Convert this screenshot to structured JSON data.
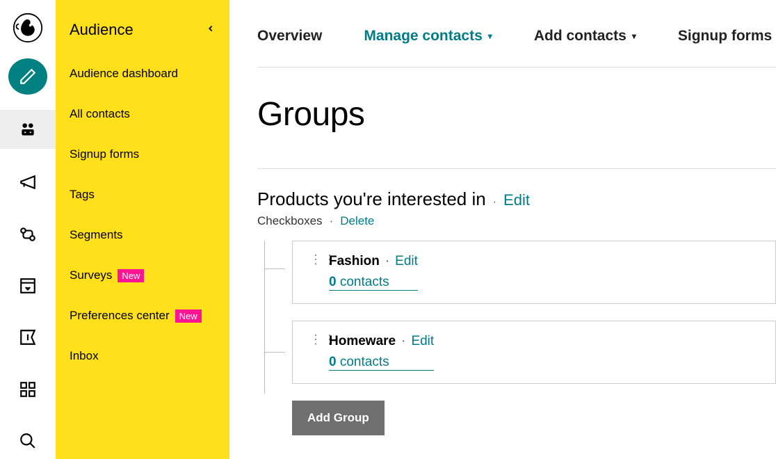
{
  "sidebar": {
    "title": "Audience",
    "items": [
      {
        "label": "Audience dashboard"
      },
      {
        "label": "All contacts"
      },
      {
        "label": "Signup forms"
      },
      {
        "label": "Tags"
      },
      {
        "label": "Segments"
      },
      {
        "label": "Surveys",
        "badge": "New"
      },
      {
        "label": "Preferences center",
        "badge": "New"
      },
      {
        "label": "Inbox"
      }
    ],
    "badge_text": "New"
  },
  "tabs": {
    "overview": "Overview",
    "manage": "Manage contacts",
    "add": "Add contacts",
    "signup": "Signup forms"
  },
  "page": {
    "title": "Groups"
  },
  "category": {
    "title": "Products you're interested in",
    "edit": "Edit",
    "type": "Checkboxes",
    "delete": "Delete"
  },
  "groups": [
    {
      "name": "Fashion",
      "edit": "Edit",
      "count": "0",
      "contacts_word": "contacts"
    },
    {
      "name": "Homeware",
      "edit": "Edit",
      "count": "0",
      "contacts_word": "contacts"
    }
  ],
  "buttons": {
    "add_group": "Add Group"
  }
}
